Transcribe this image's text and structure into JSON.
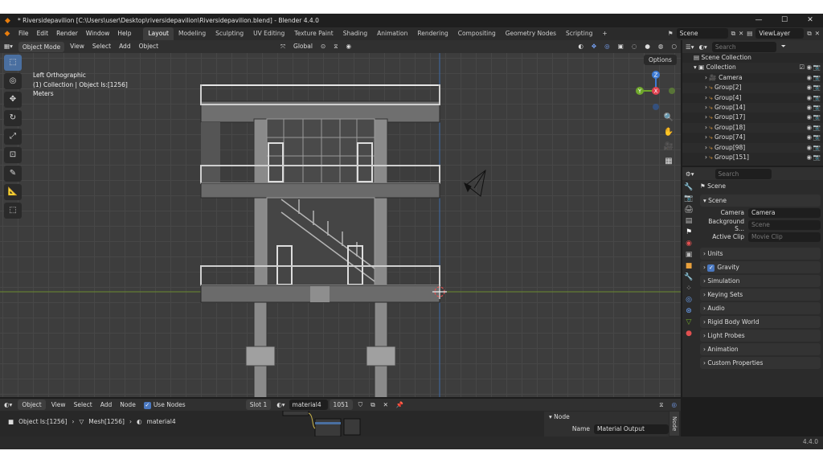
{
  "window": {
    "title": "* Riversidepavilion [C:\\Users\\user\\Desktop\\riversidepavilion\\Riversidepavilion.blend] - Blender 4.4.0",
    "minimize": "—",
    "maximize": "☐",
    "close": "✕"
  },
  "menu": {
    "items": [
      "File",
      "Edit",
      "Render",
      "Window",
      "Help"
    ],
    "workspaces": [
      "Layout",
      "Modeling",
      "Sculpting",
      "UV Editing",
      "Texture Paint",
      "Shading",
      "Animation",
      "Rendering",
      "Compositing",
      "Geometry Nodes",
      "Scripting"
    ],
    "add_tab": "+",
    "scene": "Scene",
    "view_layer": "ViewLayer"
  },
  "viewport_header": {
    "mode": "Object Mode",
    "menus": [
      "View",
      "Select",
      "Add",
      "Object"
    ],
    "transform_orientation": "Global",
    "options": "Options"
  },
  "viewport_info": {
    "view": "Left Orthographic",
    "collection": "(1) Collection | Object Is:[1256]",
    "units": "Meters"
  },
  "gizmo": {
    "z": "Z",
    "y": "Y",
    "x": "X"
  },
  "outliner": {
    "search_placeholder": "Search",
    "root": "Scene Collection",
    "collection": "Collection",
    "items": [
      "Camera",
      "Group[2]",
      "Group[4]",
      "Group[14]",
      "Group[17]",
      "Group[18]",
      "Group[74]",
      "Group[98]",
      "Group[151]"
    ]
  },
  "properties": {
    "search_placeholder": "Search",
    "context": "Scene",
    "panel_scene": "Scene",
    "camera_label": "Camera",
    "camera_value": "Camera",
    "background_label": "Background S...",
    "background_value": "Scene",
    "active_clip_label": "Active Clip",
    "active_clip_value": "Movie Clip",
    "panels": [
      "Units",
      "Gravity",
      "Simulation",
      "Keying Sets",
      "Audio",
      "Rigid Body World",
      "Light Probes",
      "Animation",
      "Custom Properties"
    ]
  },
  "node_header": {
    "object": "Object",
    "menus": [
      "View",
      "Select",
      "Add",
      "Node"
    ],
    "use_nodes": "Use Nodes",
    "slot": "Slot 1",
    "material": "material4",
    "users": "1051"
  },
  "breadcrumb": {
    "object": "Object Is:[1256]",
    "mesh": "Mesh[1256]",
    "material": "material4"
  },
  "node_sidebar": {
    "header": "Node",
    "name_label": "Name",
    "name_value": "Material Output",
    "tab": "Node"
  },
  "status": {
    "version": "4.4.0"
  },
  "colors": {
    "accent": "#4a78c0",
    "orange": "#e87d0d",
    "x_axis": "#e0414f",
    "y_axis": "#6fa82b",
    "z_axis": "#3d7bd5"
  }
}
